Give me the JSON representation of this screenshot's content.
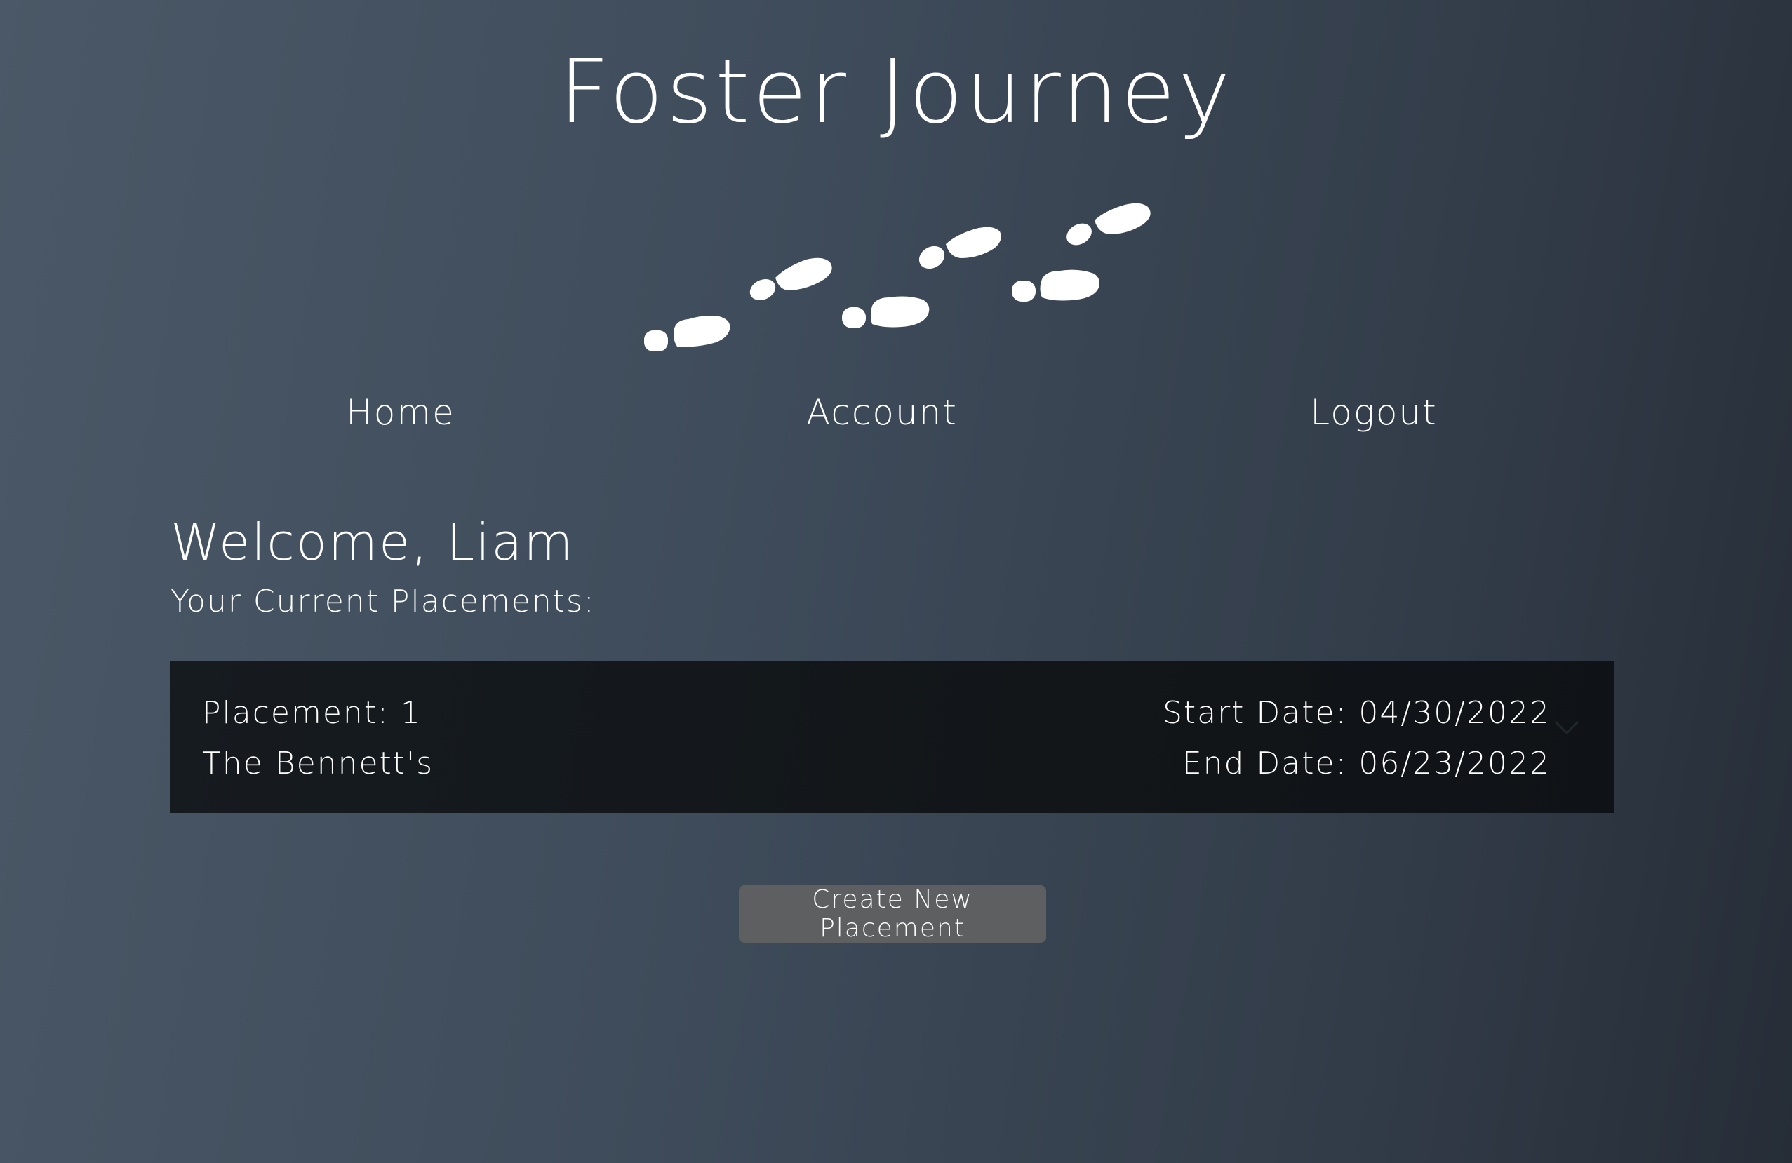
{
  "app": {
    "title": "Foster Journey",
    "logo_icon": "footprints-icon"
  },
  "nav": {
    "items": [
      {
        "label": "Home"
      },
      {
        "label": "Account"
      },
      {
        "label": "Logout"
      }
    ]
  },
  "main": {
    "welcome": "Welcome, Liam",
    "subtitle": "Your Current Placements:",
    "placements": [
      {
        "placement": "Placement: 1",
        "family": "The Bennett's",
        "start_date": "Start Date: 04/30/2022",
        "end_date": "End Date: 06/23/2022",
        "expand_icon": "chevron-down-icon"
      }
    ],
    "create_button": "Create New Placement"
  },
  "colors": {
    "background_start": "#4a5867",
    "background_end": "#262d37",
    "card_background": "#121619",
    "button_background": "#5e5f60",
    "text": "#ffffff"
  }
}
